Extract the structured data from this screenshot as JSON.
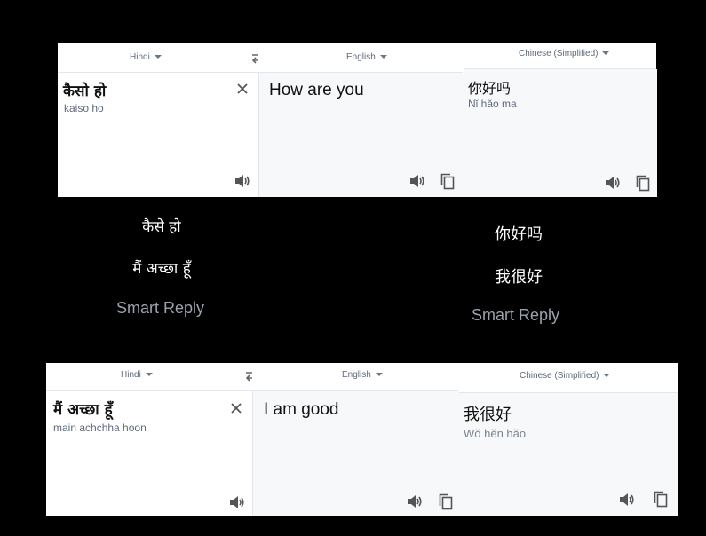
{
  "top": {
    "source_lang": "Hindi",
    "middle_lang": "English",
    "right_lang": "Chinese (Simplified)",
    "source_text": "कैसो हो",
    "source_roman": "kaiso ho",
    "middle_text": "How are you",
    "right_text": "你好吗",
    "right_roman": "Nǐ hǎo ma"
  },
  "middle": {
    "left_line1": "कैसे हो",
    "left_line2": "मैं अच्छा हूँ",
    "left_smart": "Smart Reply",
    "right_line1": "你好吗",
    "right_line2": "我很好",
    "right_smart": "Smart Reply"
  },
  "bottom": {
    "source_lang": "Hindi",
    "middle_lang": "English",
    "right_lang": "Chinese (Simplified)",
    "source_text": "मैं अच्छा हूँ",
    "source_roman": "main achchha hoon",
    "middle_text": "I am good",
    "right_text": "我很好",
    "right_roman": "Wǒ hěn hǎo"
  },
  "icons": {
    "swap": "swap-arrows-icon",
    "clear": "close-icon",
    "speaker": "speaker-icon",
    "copy": "copy-icon"
  }
}
